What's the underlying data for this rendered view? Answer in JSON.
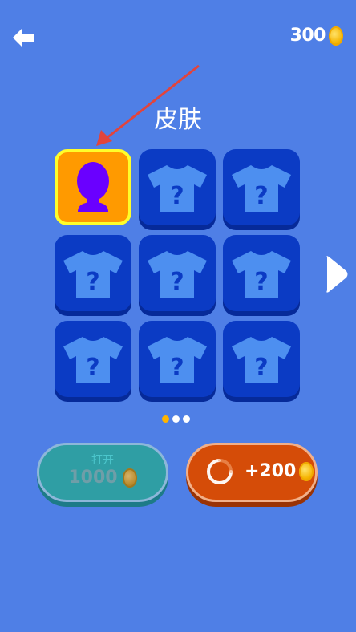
{
  "header": {
    "back_icon": "back-arrow-icon",
    "coin_count": "300",
    "coin_icon": "coin-icon"
  },
  "title": "皮肤",
  "skins": [
    {
      "state": "selected",
      "icon": "avatar-silhouette-icon"
    },
    {
      "state": "locked",
      "icon": "tshirt-question-icon"
    },
    {
      "state": "locked",
      "icon": "tshirt-question-icon"
    },
    {
      "state": "locked",
      "icon": "tshirt-question-icon"
    },
    {
      "state": "locked",
      "icon": "tshirt-question-icon"
    },
    {
      "state": "locked",
      "icon": "tshirt-question-icon"
    },
    {
      "state": "locked",
      "icon": "tshirt-question-icon"
    },
    {
      "state": "locked",
      "icon": "tshirt-question-icon"
    },
    {
      "state": "locked",
      "icon": "tshirt-question-icon"
    }
  ],
  "pagination": {
    "current": 1,
    "total": 3
  },
  "open_button": {
    "label": "打开",
    "price": "1000"
  },
  "ad_button": {
    "reward": "+200"
  },
  "colors": {
    "background": "#4f7fe6",
    "cell": "#0b3bc4",
    "selected_cell": "#ff9a00",
    "selected_border": "#fffe2a",
    "shirt": "#4d8ff0",
    "avatar": "#6a00ff",
    "open_button": "#2f9ea4",
    "ad_button": "#d54c08",
    "annotation_arrow": "#e2443c"
  }
}
